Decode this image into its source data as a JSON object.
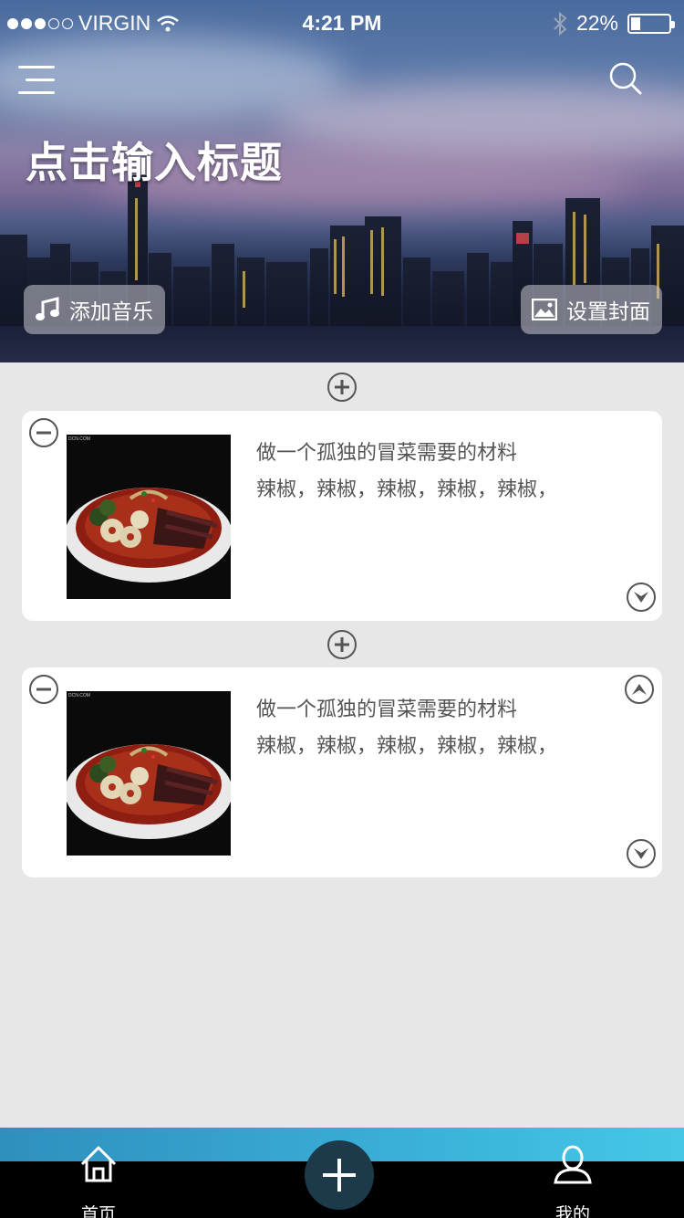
{
  "status_bar": {
    "carrier": "VIRGIN",
    "time": "4:21 PM",
    "battery": "22%",
    "battery_level": 0.22,
    "signal_dots_filled": 3,
    "signal_dots_total": 5
  },
  "header": {
    "title": "点击输入标题",
    "add_music_label": "添加音乐",
    "set_cover_label": "设置封面",
    "menu_icon": "hamburger-icon",
    "search_icon": "search-icon"
  },
  "cards": [
    {
      "title": "做一个孤独的冒菜需要的材料",
      "description": "辣椒，辣椒，辣椒，辣椒，辣椒，",
      "show_move_up": false
    },
    {
      "title": "做一个孤独的冒菜需要的材料",
      "description": "辣椒，辣椒，辣椒，辣椒，辣椒，",
      "show_move_up": true
    }
  ],
  "tabbar": {
    "home_label": "首页",
    "mine_label": "我的",
    "accent_left": "#2f8fbd",
    "accent_right": "#45c8e6"
  }
}
